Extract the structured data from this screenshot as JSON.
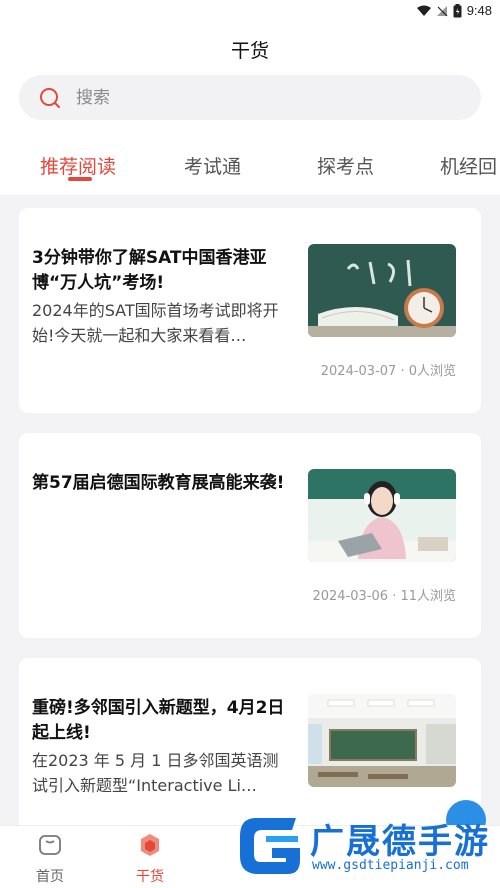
{
  "status_bar": {
    "time": "9:48"
  },
  "header": {
    "title": "干货"
  },
  "search": {
    "placeholder": "搜索"
  },
  "tabs": [
    "推荐阅读",
    "考试通",
    "探考点",
    "机经回"
  ],
  "articles": [
    {
      "title": "3分钟带你了解SAT中国香港亚博“万人坑”考场!",
      "summary": "2024年的SAT国际首场考试即将开始!今天就一起和大家来看看…",
      "date": "2024-03-07",
      "views": "0人浏览"
    },
    {
      "title": "第57届启德国际教育展高能来袭!",
      "summary": "",
      "date": "2024-03-06",
      "views": "11人浏览"
    },
    {
      "title": "重磅!多邻国引入新题型，4月2日起上线!",
      "summary": "在2023 年 5 月 1 日多邻国英语测试引入新题型“Interactive Li…",
      "date": "",
      "views": ""
    }
  ],
  "bottom_nav": [
    {
      "label": "首页"
    },
    {
      "label": "干货"
    }
  ],
  "watermark": {
    "title": "广晟德手游",
    "url": "www.gsdtiepianji.com"
  },
  "colors": {
    "accent": "#e2493b",
    "watermark": "#1670d6"
  }
}
